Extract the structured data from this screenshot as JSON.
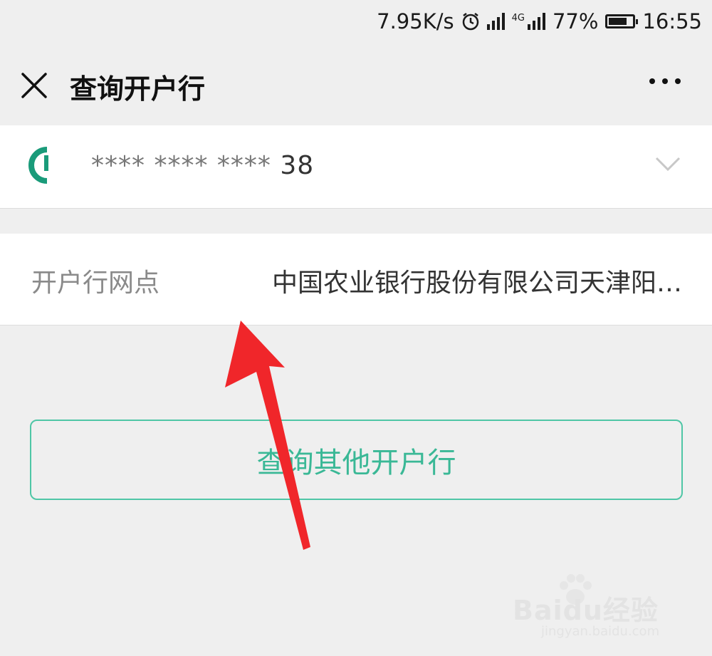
{
  "status_bar": {
    "speed": "7.95K/s",
    "network": "4G",
    "battery": "77%",
    "battery_level": 0.77,
    "time": "16:55",
    "icons": [
      "alarm-icon",
      "signal-icon",
      "battery-icon"
    ]
  },
  "header": {
    "title": "查询开户行",
    "close_icon": "close-icon",
    "more_icon": "more-icon"
  },
  "card": {
    "number_masked": "**** **** ****",
    "number_visible": "38",
    "logo_icon": "bank-logo-icon",
    "dropdown_icon": "chevron-down-icon"
  },
  "branch": {
    "label": "开户行网点",
    "value": "中国农业银行股份有限公司天津阳…"
  },
  "actions": {
    "query_other": "查询其他开户行"
  },
  "watermark": {
    "main": "Baidu经验",
    "sub": "jingyan.baidu.com"
  },
  "colors": {
    "accent": "#3ab896",
    "annotation_arrow": "#f0262a",
    "background": "#efefef"
  }
}
